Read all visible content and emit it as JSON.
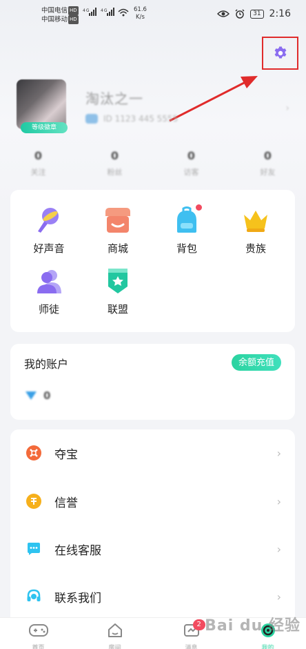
{
  "status_bar": {
    "carrier1": "中国电信",
    "carrier2": "中国移动",
    "hd": "HD",
    "net": "4G 4G",
    "speed_value": "61.6",
    "speed_unit": "K/s",
    "battery": "31",
    "time": "2:16"
  },
  "profile": {
    "nickname": "淘汰之一",
    "user_id": "ID 1123 445 5555",
    "level": "等级徽章",
    "chevron": "›"
  },
  "stats": [
    {
      "num": "0",
      "label": "关注"
    },
    {
      "num": "0",
      "label": "粉丝"
    },
    {
      "num": "0",
      "label": "访客"
    },
    {
      "num": "0",
      "label": "好友"
    }
  ],
  "features": [
    {
      "label": "好声音",
      "icon": "microphone-icon"
    },
    {
      "label": "商城",
      "icon": "shop-icon"
    },
    {
      "label": "背包",
      "icon": "backpack-icon"
    },
    {
      "label": "贵族",
      "icon": "crown-icon"
    },
    {
      "label": "师徒",
      "icon": "mentor-icon"
    },
    {
      "label": "联盟",
      "icon": "alliance-shield-icon"
    }
  ],
  "account": {
    "title": "我的账户",
    "recharge": "余额充值",
    "balance": "0"
  },
  "menu": [
    {
      "label": "夺宝",
      "icon": "treasure-icon",
      "color": "#f36a3a"
    },
    {
      "label": "信誉",
      "icon": "credit-icon",
      "color": "#f6b01c"
    },
    {
      "label": "在线客服",
      "icon": "chat-icon",
      "color": "#2ec3f0"
    },
    {
      "label": "联系我们",
      "icon": "headset-icon",
      "color": "#2ec3f0"
    }
  ],
  "tabbar": {
    "tabs": [
      {
        "label": "首页",
        "icon": "gamepad-icon"
      },
      {
        "label": "房间",
        "icon": "home-icon"
      },
      {
        "label": "消息",
        "icon": "message-icon",
        "badge": "2"
      },
      {
        "label": "我的",
        "icon": "profile-tab-icon"
      }
    ]
  },
  "watermark": "Bai du 经验",
  "colors": {
    "accent": "#2bd3a0",
    "settings": "#8a6cf0",
    "highlight": "#e02b2b"
  }
}
